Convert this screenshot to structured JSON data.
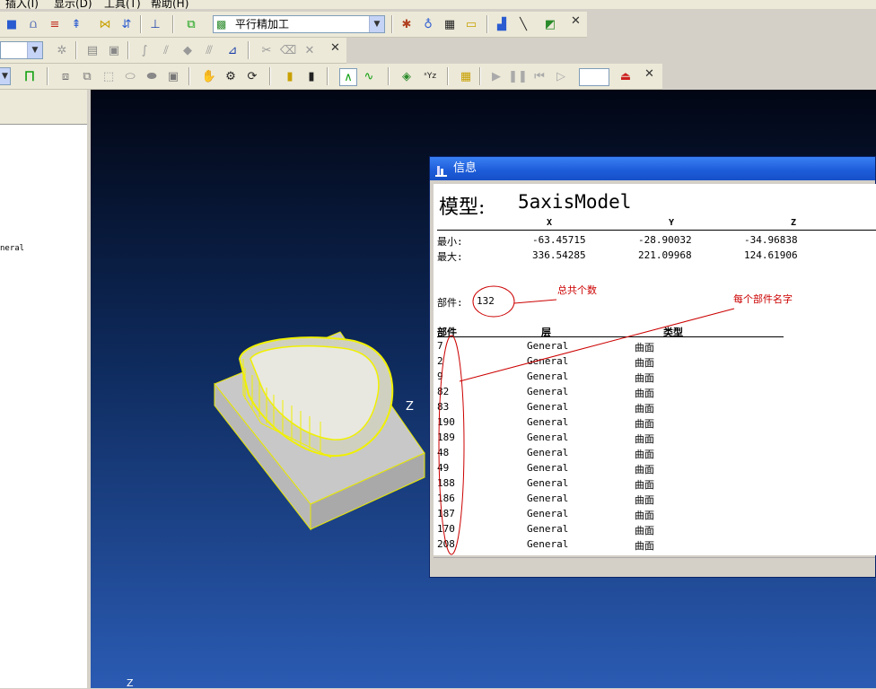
{
  "menubar": {
    "items": [
      "插入(I)",
      "显示(D)",
      "工具(T)",
      "帮助(H)"
    ]
  },
  "toolbar1": {
    "strategy_selected": "平行精加工"
  },
  "left_panel": {
    "tree_item": "neral"
  },
  "viewport": {
    "axis_z_label": "Z",
    "axis_z_bottom_label": "Z"
  },
  "info_window": {
    "title": "信息",
    "model_label": "模型:",
    "model_name": "5axisModel",
    "col_x": "X",
    "col_y": "Y",
    "col_z": "Z",
    "min_label": "最小:",
    "max_label": "最大:",
    "min": {
      "x": "-63.45715",
      "y": "-28.90032",
      "z": "-34.96838"
    },
    "max": {
      "x": "336.54285",
      "y": "221.09968",
      "z": "124.61906"
    },
    "parts_label": "部件:",
    "parts_count": "132",
    "table_headers": {
      "part": "部件",
      "layer": "层",
      "type": "类型"
    },
    "rows": [
      {
        "part": "7",
        "layer": "General",
        "type": "曲面"
      },
      {
        "part": "2",
        "layer": "General",
        "type": "曲面"
      },
      {
        "part": "9",
        "layer": "General",
        "type": "曲面"
      },
      {
        "part": "82",
        "layer": "General",
        "type": "曲面"
      },
      {
        "part": "83",
        "layer": "General",
        "type": "曲面"
      },
      {
        "part": "190",
        "layer": "General",
        "type": "曲面"
      },
      {
        "part": "189",
        "layer": "General",
        "type": "曲面"
      },
      {
        "part": "48",
        "layer": "General",
        "type": "曲面"
      },
      {
        "part": "49",
        "layer": "General",
        "type": "曲面"
      },
      {
        "part": "188",
        "layer": "General",
        "type": "曲面"
      },
      {
        "part": "186",
        "layer": "General",
        "type": "曲面"
      },
      {
        "part": "187",
        "layer": "General",
        "type": "曲面"
      },
      {
        "part": "170",
        "layer": "General",
        "type": "曲面"
      },
      {
        "part": "208",
        "layer": "General",
        "type": "曲面"
      }
    ]
  },
  "annotations": {
    "total_count": "总共个数",
    "each_part_name": "每个部件名字"
  },
  "colors": {
    "annotation_red": "#cc0000",
    "title_blue": "#1c5bd8"
  }
}
